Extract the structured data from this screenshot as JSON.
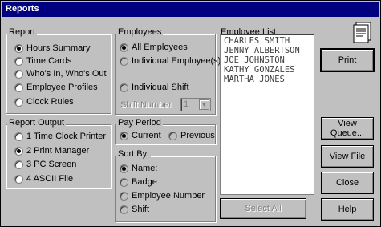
{
  "window": {
    "title": "Reports"
  },
  "report": {
    "label": "Report",
    "options": [
      {
        "label": "Hours Summary",
        "checked": true
      },
      {
        "label": "Time Cards",
        "checked": false
      },
      {
        "label": "Who's In, Who's Out",
        "checked": false
      },
      {
        "label": "Employee Profiles",
        "checked": false
      },
      {
        "label": "Clock Rules",
        "checked": false
      }
    ]
  },
  "report_output": {
    "label": "Report Output",
    "options": [
      {
        "label": "1 Time Clock Printer",
        "checked": false
      },
      {
        "label": "2 Print Manager",
        "checked": true
      },
      {
        "label": "3 PC Screen",
        "checked": false
      },
      {
        "label": "4 ASCII File",
        "checked": false
      }
    ]
  },
  "employees": {
    "label": "Employees",
    "all": "All Employees",
    "individual": "Individual Employee(s)",
    "individual_shift": "Individual Shift",
    "shift_number_label": "Shift Number",
    "shift_number_value": "1"
  },
  "pay_period": {
    "label": "Pay Period",
    "current": "Current",
    "previous": "Previous"
  },
  "sort_by": {
    "label": "Sort By:",
    "options": [
      {
        "label": "Name:",
        "checked": true
      },
      {
        "label": "Badge",
        "checked": false
      },
      {
        "label": "Employee Number",
        "checked": false
      },
      {
        "label": "Shift",
        "checked": false
      }
    ]
  },
  "employee_list": {
    "label": "Employee List",
    "items": [
      "CHARLES SMITH",
      "JENNY ALBERTSON",
      "JOE JOHNSTON",
      "KATHY GONZALES",
      "MARTHA JONES"
    ]
  },
  "buttons": {
    "print": "Print",
    "view_queue": "View Queue...",
    "view_file": "View File",
    "close": "Close",
    "help": "Help",
    "select_all": "Select All"
  },
  "icons": {
    "report": "report-document-icon"
  }
}
